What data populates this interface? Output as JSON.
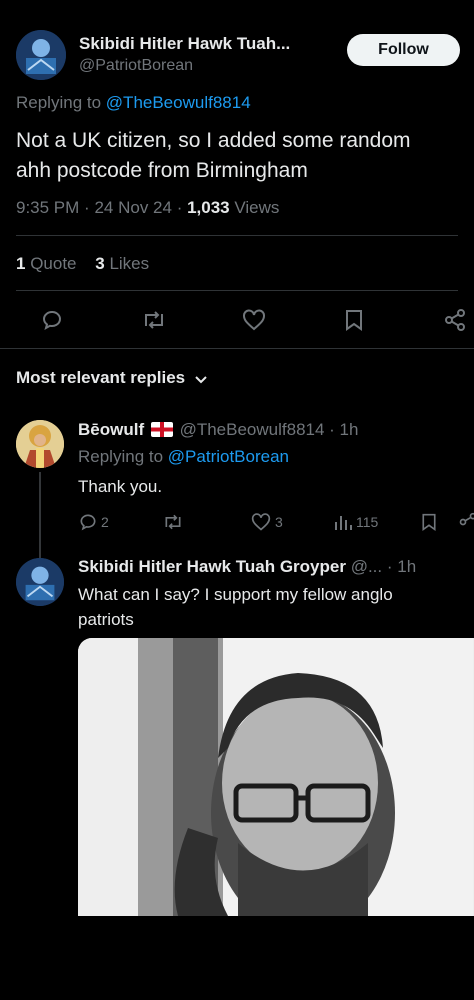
{
  "main_tweet": {
    "author_name": "Skibidi Hitler Hawk Tuah...",
    "author_handle": "@PatriotBorean",
    "follow_label": "Follow",
    "replying_prefix": "Replying to",
    "replying_to": "@TheBeowulf8814",
    "text_line1": "Not a UK citizen, so I added some random",
    "text_line2": "ahh postcode from Birmingham",
    "time": "9:35 PM",
    "date": "24 Nov 24",
    "views_count": "1,033",
    "views_label": "Views",
    "quote_count": "1",
    "quote_label": "Quote",
    "likes_count": "3",
    "likes_label": "Likes"
  },
  "replies_header": "Most relevant replies",
  "replies": [
    {
      "author_name": "Bēowulf",
      "author_handle": "@TheBeowulf8814",
      "time": "· 1h",
      "replying_prefix": "Replying to",
      "replying_to": "@PatriotBorean",
      "text": "Thank you.",
      "reply_count": "2",
      "like_count": "3",
      "view_count": "115"
    },
    {
      "author_name": "Skibidi Hitler Hawk Tuah Groyper",
      "author_handle": "@...",
      "time": "· 1h",
      "text_line1": "What can I say? I support my fellow anglo",
      "text_line2": "patriots"
    }
  ],
  "icons": [
    "reply-icon",
    "retweet-icon",
    "like-icon",
    "bookmark-icon",
    "share-icon",
    "views-icon",
    "chevron-down-icon",
    "england-flag-icon"
  ]
}
